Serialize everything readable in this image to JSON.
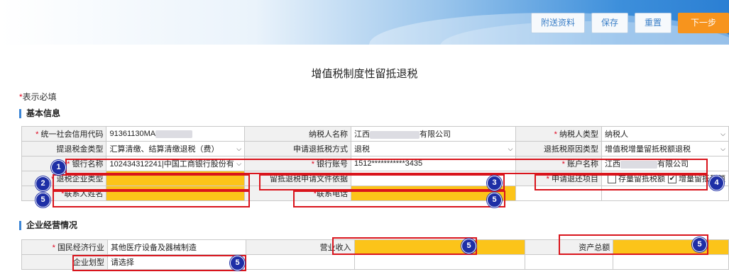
{
  "toolbar": {
    "attach_label": "附送资料",
    "save_label": "保存",
    "reset_label": "重置",
    "next_label": "下一步"
  },
  "page_title": "增值税制度性留抵退税",
  "required_note": "表示必填",
  "required_star": "*",
  "sections": {
    "basic": "基本信息",
    "business": "企业经营情况"
  },
  "basic": {
    "credit_code_label": "统一社会信用代码",
    "credit_code_value": "91361130MA",
    "taxpayer_name_label": "纳税人名称",
    "taxpayer_name_prefix": "江西",
    "taxpayer_name_suffix": "有限公司",
    "taxpayer_type_label": "纳税人类型",
    "taxpayer_type_value": "纳税人",
    "refund_type_label": "提退税金类型",
    "refund_type_value": "汇算清缴、结算清缴退税（费）",
    "refund_method_label": "申请退抵税方式",
    "refund_method_value": "退税",
    "refund_reason_label": "退抵税原因类型",
    "refund_reason_value": "增值税增量留抵税额退税",
    "bank_name_label": "银行名称",
    "bank_name_value": "102434312241|中国工商银行股份有",
    "bank_account_label": "银行账号",
    "bank_account_value": "1512***********3435",
    "account_name_label": "账户名称",
    "account_name_prefix": "江西",
    "account_name_suffix": "有限公司",
    "enterprise_type_label": "退税企业类型",
    "basis_doc_label": "留抵退税申请文件依据",
    "refund_item_label": "申请退还项目",
    "option_stock": "存量留抵税额",
    "option_increment": "增量留抵税额",
    "contact_name_label": "联系人姓名",
    "contact_phone_label": "联系电话"
  },
  "business": {
    "industry_label": "国民经济行业",
    "industry_value": "其他医疗设备及器械制造",
    "revenue_label": "营业收入",
    "assets_label": "资产总额",
    "size_label": "企业划型",
    "size_value": "请选择"
  },
  "annotations": [
    "1",
    "2",
    "3",
    "4",
    "5",
    "5",
    "5",
    "5",
    "5",
    "5"
  ],
  "colors": {
    "accent": "#3d86d6",
    "required": "#e0001b",
    "highlight": "#fcc419",
    "annotation_border": "#d9141c",
    "badge": "#1e2fa6",
    "next_button": "#f7941d"
  }
}
